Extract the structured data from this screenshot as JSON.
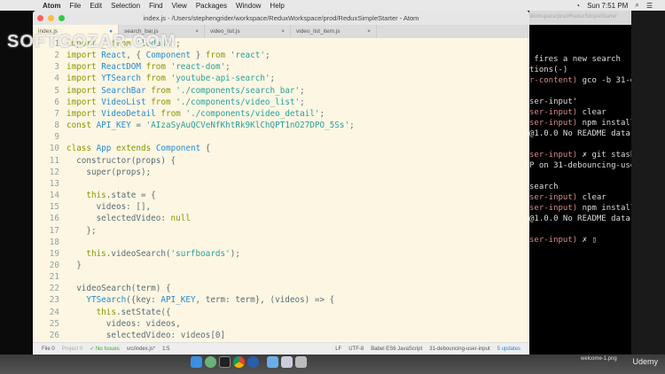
{
  "menubar": {
    "items": [
      "Atom",
      "File",
      "Edit",
      "Selection",
      "Find",
      "View",
      "Packages",
      "Window",
      "Help"
    ],
    "clock": "Sun 7:51 PM"
  },
  "window": {
    "title": "index.js - /Users/stephengrider/workspace/ReduxWorkspace/prod/ReduxSimpleStarter - Atom",
    "tabs": [
      {
        "label": "index.js"
      },
      {
        "label": "search_bar.js"
      },
      {
        "label": "video_list.js"
      },
      {
        "label": "video_list_item.js"
      }
    ]
  },
  "editor": {
    "lines": [
      "import _ from 'lodash';",
      "import React, { Component } from 'react';",
      "import ReactDOM from 'react-dom';",
      "import YTSearch from 'youtube-api-search';",
      "import SearchBar from './components/search_bar';",
      "import VideoList from './components/video_list';",
      "import VideoDetail from './components/video_detail';",
      "const API_KEY = 'AIzaSyAuQCVeNfKhtRk9KlChQPT1nO27DPO_5Ss';",
      "",
      "class App extends Component {",
      "  constructor(props) {",
      "    super(props);",
      "",
      "    this.state = {",
      "      videos: [],",
      "      selectedVideo: null",
      "    };",
      "",
      "    this.videoSearch('surfboards');",
      "  }",
      "",
      "  videoSearch(term) {",
      "    YTSearch({key: API_KEY, term: term}, (videos) => {",
      "      this.setState({",
      "        videos: videos,",
      "        selectedVideo: videos[0]"
    ]
  },
  "status": {
    "file": "File 0",
    "project": "Project 0",
    "issues": "✓ No Issues",
    "path": "src/index.js*",
    "cursor": "1:5",
    "eol": "LF",
    "encoding": "UTF-8",
    "grammar": "Babel ES6 JavaScript",
    "branch": "31-debouncing-user-input",
    "updates": "5 updates"
  },
  "terminal": {
    "header": "Workspace/prod/ReduxSimpleStarter",
    "lines": [
      {
        "a": "",
        "b": " fires a new search"
      },
      {
        "a": "",
        "b": "tions(-)"
      },
      {
        "a": "r-content)",
        "b": " gco -b 31-d"
      },
      {
        "a": "",
        "b": ""
      },
      {
        "a": "",
        "b": "ser-input'"
      },
      {
        "a": "ser-input)",
        "b": " clear"
      },
      {
        "a": "ser-input)",
        "b": " npm install"
      },
      {
        "a": "",
        "b": "@1.0.0 No README data"
      },
      {
        "a": "",
        "b": ""
      },
      {
        "a": "ser-input)",
        "b": " ✗ git stash"
      },
      {
        "a": "",
        "b": "P on 31-debouncing-use"
      },
      {
        "a": "",
        "b": ""
      },
      {
        "a": "",
        "b": "search"
      },
      {
        "a": "ser-input)",
        "b": " clear"
      },
      {
        "a": "ser-input)",
        "b": " npm install"
      },
      {
        "a": "",
        "b": "@1.0.0 No README data"
      },
      {
        "a": "",
        "b": ""
      },
      {
        "a": "ser-input)",
        "b": " ✗ ▯"
      }
    ]
  },
  "desktop": {
    "file_label": "welcome-1.png",
    "brand": "Udemy"
  },
  "watermark": "SOFTGOZAR.COM"
}
